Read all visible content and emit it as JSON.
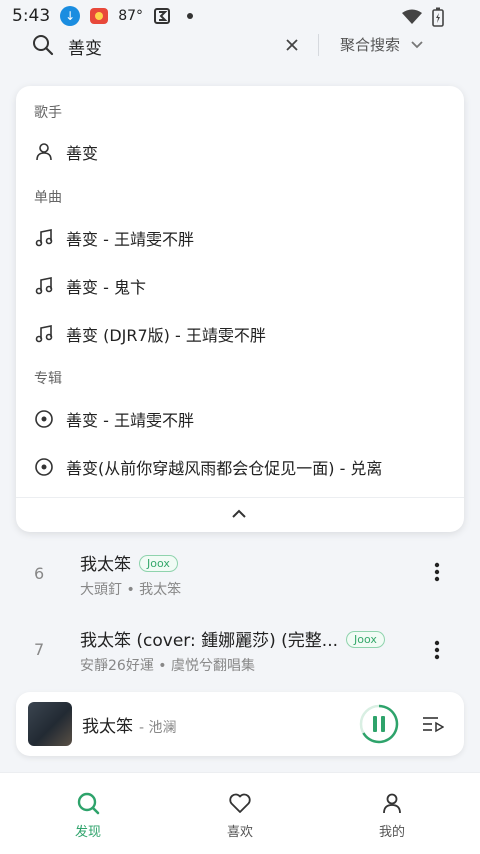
{
  "status_bar": {
    "time": "5:43",
    "temperature": "87°"
  },
  "search": {
    "query": "善变",
    "mode_label": "聚合搜索"
  },
  "suggestions": {
    "artist_section": "歌手",
    "artists": [
      {
        "text": "善变"
      }
    ],
    "song_section": "单曲",
    "songs": [
      {
        "text": "善变 - 王靖雯不胖"
      },
      {
        "text": "善变 - 鬼卞"
      },
      {
        "text": "善变 (DJR7版) - 王靖雯不胖"
      }
    ],
    "album_section": "专辑",
    "albums": [
      {
        "text": "善变 - 王靖雯不胖"
      },
      {
        "text": "善变(从前你穿越风雨都会仓促见一面) - 兑离"
      }
    ]
  },
  "results": [
    {
      "index": "6",
      "title": "我太笨",
      "tag": "Joox",
      "subtitle": "大頭釘 • 我太笨"
    },
    {
      "index": "7",
      "title": "我太笨 (cover: 鍾娜麗莎) (完整...",
      "tag": "Joox",
      "subtitle": "安靜26好運 • 虞悦兮翻唱集"
    }
  ],
  "player": {
    "song": "我太笨",
    "artist": "- 池澜"
  },
  "nav": {
    "discover": "发现",
    "favorites": "喜欢",
    "mine": "我的"
  },
  "colors": {
    "accent": "#2ea36b",
    "tag_border": "#8fd3ad",
    "download_badge": "#1a8de0"
  },
  "icons": [
    "search-icon",
    "close-icon",
    "chevron-down-icon",
    "person-icon",
    "music-note-icon",
    "disc-icon",
    "chevron-up-icon",
    "more-vertical-icon",
    "pause-icon",
    "playlist-icon",
    "heart-icon",
    "user-icon"
  ]
}
